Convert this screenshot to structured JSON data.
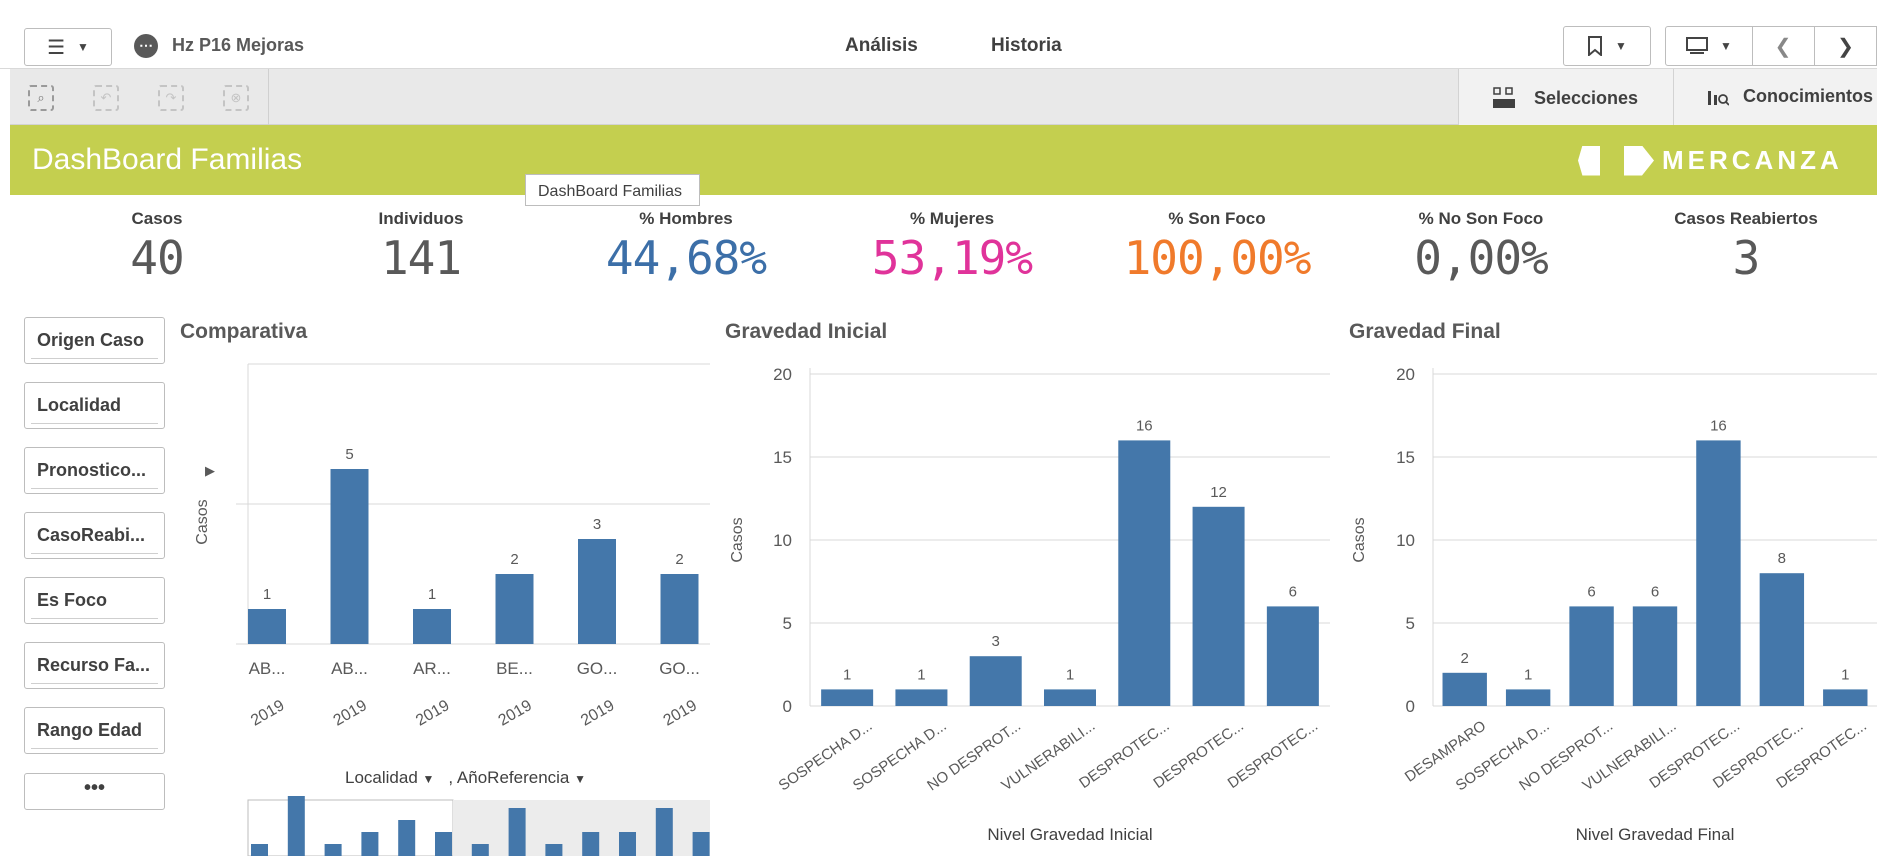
{
  "header": {
    "app_title": "Hz P16 Mejoras",
    "app_icon": "more-dots-icon",
    "tabs": [
      {
        "label": "Análisis",
        "active": true
      },
      {
        "label": "Historia",
        "active": false
      }
    ],
    "accent_color": "#ef960d"
  },
  "toolbar": {
    "selections_label": "Selecciones",
    "insights_label": "Conocimientos"
  },
  "banner": {
    "title": "DashBoard Familias",
    "logo_text": "MERCANZA",
    "tooltip": "DashBoard Familias",
    "color": "#c4cf4f"
  },
  "kpis": [
    {
      "label": "Casos",
      "value": "40",
      "color": "#595959"
    },
    {
      "label": "Individuos",
      "value": "141",
      "color": "#595959"
    },
    {
      "label": "% Hombres",
      "value": "44,68%",
      "color": "#3c6fa8"
    },
    {
      "label": "% Mujeres",
      "value": "53,19%",
      "color": "#e0339a"
    },
    {
      "label": "% Son Foco",
      "value": "100,00%",
      "color": "#f07a2b"
    },
    {
      "label": "% No Son Foco",
      "value": "0,00%",
      "color": "#595959"
    },
    {
      "label": "Casos Reabiertos",
      "value": "3",
      "color": "#595959"
    }
  ],
  "filters": [
    "Origen Caso",
    "Localidad",
    "Pronostico...",
    "CasoReabi...",
    "Es Foco",
    "Recurso Fa...",
    "Rango Edad"
  ],
  "filters_more": "•••",
  "comparativa": {
    "title": "Comparativa",
    "ylabel": "Casos",
    "dimension_labels": [
      "Localidad",
      "AñoReferencia"
    ],
    "minimap": [
      1,
      5,
      1,
      2,
      3,
      2,
      1,
      4,
      1,
      2,
      2,
      4,
      2
    ]
  },
  "chart_data": [
    {
      "type": "bar",
      "title": "Comparativa",
      "ylabel": "Casos",
      "xlabel": "",
      "categories": [
        "AB...",
        "AB...",
        "AR...",
        "BE...",
        "GO...",
        "GO..."
      ],
      "subcategories": [
        "2019",
        "2019",
        "2019",
        "2019",
        "2019",
        "2019"
      ],
      "values": [
        1,
        5,
        1,
        2,
        3,
        2
      ],
      "ylim": [
        0,
        8
      ],
      "color": "#4477aa"
    },
    {
      "type": "bar",
      "title": "Gravedad Inicial",
      "ylabel": "Casos",
      "xlabel": "Nivel Gravedad Inicial",
      "categories": [
        "SOSPECHA D...",
        "SOSPECHA D...",
        "NO DESPROT...",
        "VULNERABILI...",
        "DESPROTEC...",
        "DESPROTEC...",
        "DESPROTEC..."
      ],
      "values": [
        1,
        1,
        3,
        1,
        16,
        12,
        6
      ],
      "ylim": [
        0,
        20
      ],
      "yticks": [
        0,
        5,
        10,
        15,
        20
      ],
      "color": "#4477aa"
    },
    {
      "type": "bar",
      "title": "Gravedad Final",
      "ylabel": "Casos",
      "xlabel": "Nivel Gravedad Final",
      "categories": [
        "DESAMPARO",
        "SOSPECHA D...",
        "NO DESPROT...",
        "VULNERABILI...",
        "DESPROTEC...",
        "DESPROTEC...",
        "DESPROTEC..."
      ],
      "values": [
        2,
        1,
        6,
        6,
        16,
        8,
        1
      ],
      "ylim": [
        0,
        20
      ],
      "yticks": [
        0,
        5,
        10,
        15,
        20
      ],
      "color": "#4477aa"
    }
  ]
}
